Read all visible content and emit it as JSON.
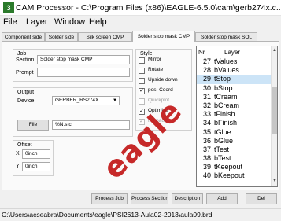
{
  "app": {
    "title": "CAM Processor - C:\\Program Files (x86)\\EAGLE-6.5.0\\cam\\gerb274x.c..."
  },
  "menu": {
    "items": [
      "File",
      "Layer",
      "Window",
      "Help"
    ]
  },
  "tabs": [
    {
      "label": "Component side",
      "active": false
    },
    {
      "label": "Solder side",
      "active": false
    },
    {
      "label": "Silk screen CMP",
      "active": false
    },
    {
      "label": "Solder stop mask CMP",
      "active": true
    },
    {
      "label": "Solder stop mask SOL",
      "active": false
    }
  ],
  "job": {
    "title": "Job",
    "section_label": "Section",
    "section_value": "Solder stop mask CMP",
    "prompt_label": "Prompt",
    "prompt_value": ""
  },
  "output": {
    "title": "Output",
    "device_label": "Device",
    "device_value": "GERBER_RS274X",
    "file_button": "File",
    "file_value": "%N.stc"
  },
  "offset": {
    "title": "Offset",
    "x_label": "X",
    "x_value": "0inch",
    "y_label": "Y",
    "y_value": "0inch"
  },
  "style": {
    "title": "Style",
    "options": [
      {
        "label": "Mirror",
        "checked": false,
        "enabled": true
      },
      {
        "label": "Rotate",
        "checked": false,
        "enabled": true
      },
      {
        "label": "Upside down",
        "checked": false,
        "enabled": true
      },
      {
        "label": "pos. Coord",
        "checked": true,
        "enabled": true
      },
      {
        "label": "Quickplot",
        "checked": false,
        "enabled": false
      },
      {
        "label": "Optimize",
        "checked": true,
        "enabled": true
      },
      {
        "label": "Fill pads",
        "checked": true,
        "enabled": false
      }
    ]
  },
  "layers": {
    "header_nr": "Nr",
    "header_layer": "Layer",
    "rows": [
      {
        "nr": "27",
        "name": "tValues",
        "selected": false
      },
      {
        "nr": "28",
        "name": "bValues",
        "selected": false
      },
      {
        "nr": "29",
        "name": "tStop",
        "selected": true
      },
      {
        "nr": "30",
        "name": "bStop",
        "selected": false
      },
      {
        "nr": "31",
        "name": "tCream",
        "selected": false
      },
      {
        "nr": "32",
        "name": "bCream",
        "selected": false
      },
      {
        "nr": "33",
        "name": "tFinish",
        "selected": false
      },
      {
        "nr": "34",
        "name": "bFinish",
        "selected": false
      },
      {
        "nr": "35",
        "name": "tGlue",
        "selected": false
      },
      {
        "nr": "36",
        "name": "bGlue",
        "selected": false
      },
      {
        "nr": "37",
        "name": "tTest",
        "selected": false
      },
      {
        "nr": "38",
        "name": "bTest",
        "selected": false
      },
      {
        "nr": "39",
        "name": "tKeepout",
        "selected": false
      },
      {
        "nr": "40",
        "name": "bKeepout",
        "selected": false
      }
    ]
  },
  "buttons": {
    "process_job": "Process Job",
    "process_section": "Process Section",
    "description": "Description",
    "add": "Add",
    "del": "Del"
  },
  "watermark": "eagle",
  "status": {
    "path": "C:\\Users\\acseabra\\Documents\\eagle\\PSI2613-Aula02-2013\\aula09.brd"
  },
  "colors": {
    "selection": "#cce4f7",
    "watermark": "#c41e1e"
  }
}
